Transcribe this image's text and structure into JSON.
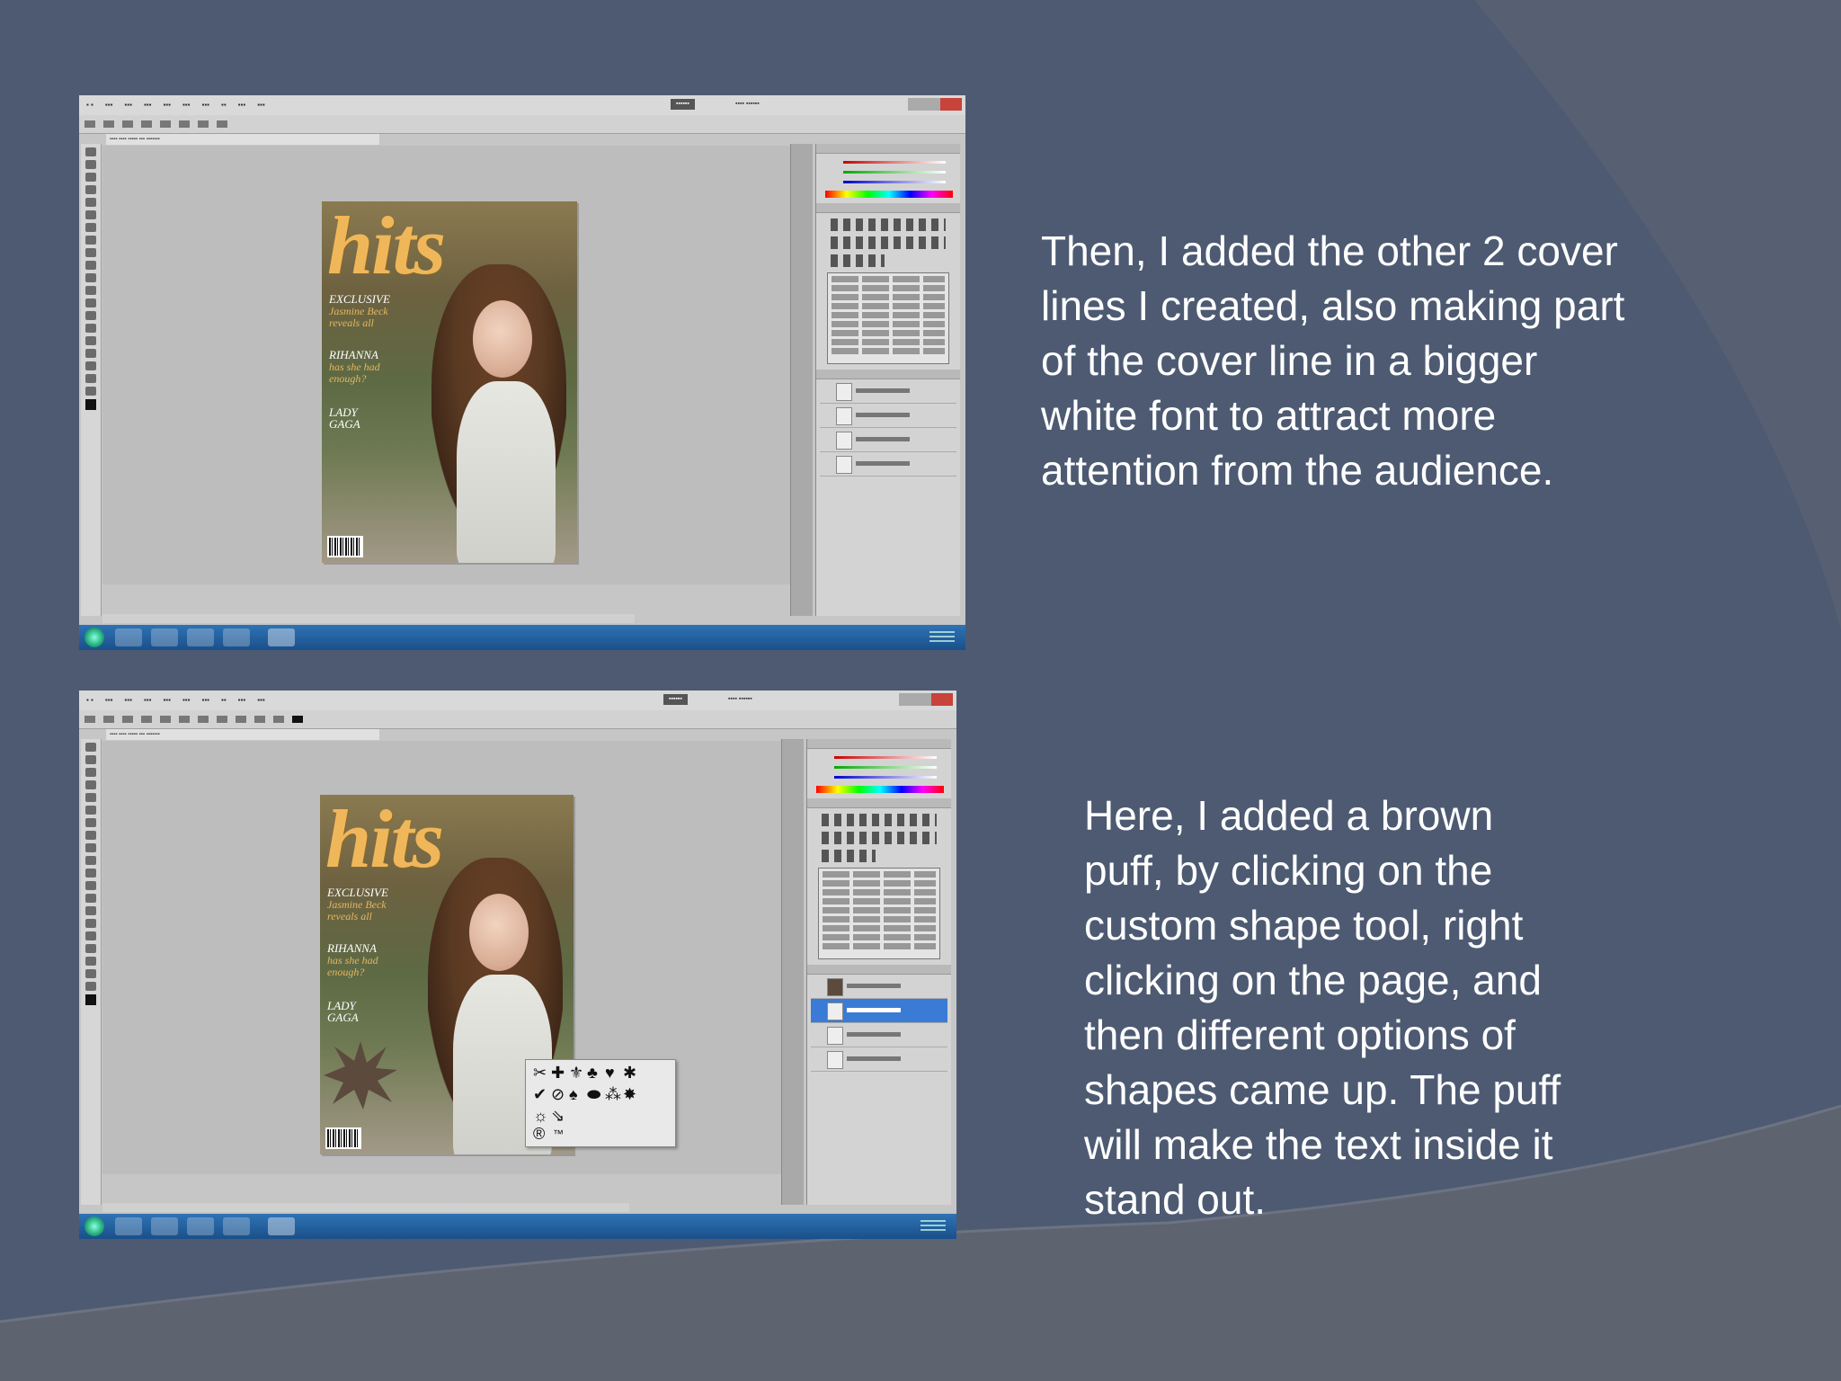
{
  "slide": {
    "caption_top": "Then, I added the other 2 cover\nlines I created, also making part\nof the cover line in a bigger\nwhite font to attract more\nattention from the audience.",
    "caption_bottom": "Here, I added a brown\npuff, by clicking on the\ncustom shape tool, right\nclicking on the page, and\nthen different options of\nshapes came up. The puff\nwill make the text inside it\nstand out."
  },
  "colors": {
    "background": "#4d5a72",
    "background_curve": "#5a6070",
    "caption_text": "#ffffff",
    "masthead": "#f0b75a",
    "puff": "#5c4a3c",
    "selected_layer": "#3a7bd5"
  },
  "screenshot_top": {
    "magazine": {
      "masthead": "hits",
      "cover_lines": [
        {
          "main": "EXCLUSIVE",
          "sub": "Jasmine Beck\nreveals all"
        },
        {
          "main": "RIHANNA",
          "sub": "has she had\nenough?"
        },
        {
          "main": "LADY\nGAGA",
          "sub": ""
        }
      ]
    }
  },
  "screenshot_bottom": {
    "magazine": {
      "masthead": "hits",
      "cover_lines": [
        {
          "main": "EXCLUSIVE",
          "sub": "Jasmine Beck\nreveals all"
        },
        {
          "main": "RIHANNA",
          "sub": "has she had\nenough?"
        },
        {
          "main": "LADY\nGAGA",
          "sub": ""
        }
      ]
    },
    "shape_picker": {
      "glyphs": [
        "✂",
        "✚",
        "⚜",
        "♣",
        "♥",
        "✱",
        "✔",
        "⊘",
        "♠",
        "⬬",
        "⁂",
        "✸",
        "☼",
        "⇘",
        "™",
        "®"
      ]
    }
  }
}
